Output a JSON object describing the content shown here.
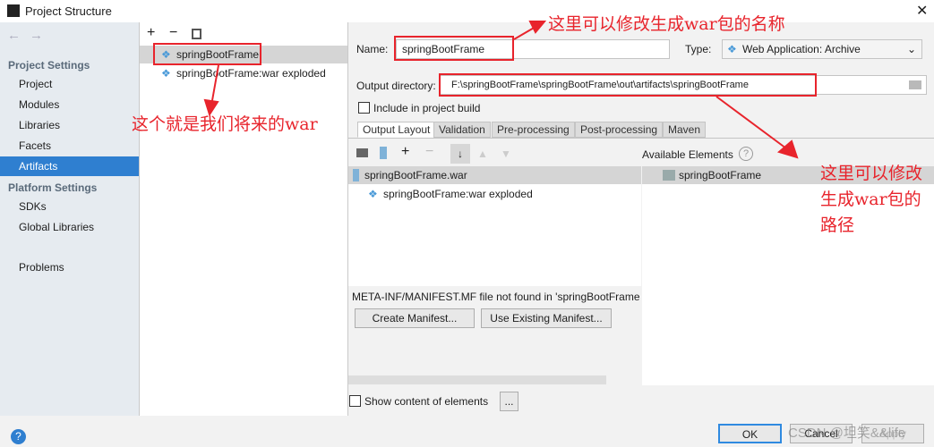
{
  "window": {
    "title": "Project Structure",
    "close_icon": "close-icon"
  },
  "sidebar": {
    "sections": [
      {
        "label": "Project Settings",
        "items": [
          "Project",
          "Modules",
          "Libraries",
          "Facets",
          "Artifacts"
        ]
      },
      {
        "label": "Platform Settings",
        "items": [
          "SDKs",
          "Global Libraries"
        ]
      }
    ],
    "extra": "Problems",
    "selected": "Artifacts"
  },
  "artifacts": {
    "items": [
      "springBootFrame",
      "springBootFrame:war exploded"
    ],
    "selected": "springBootFrame"
  },
  "form": {
    "name_label": "Name:",
    "name_value": "springBootFrame",
    "type_label": "Type:",
    "type_value": "Web Application: Archive",
    "output_label": "Output directory:",
    "output_value": "F:\\springBootFrame\\springBootFrame\\out\\artifacts\\springBootFrame",
    "include_label": "Include in project build",
    "include_checked": false
  },
  "tabs": [
    "Output Layout",
    "Validation",
    "Pre-processing",
    "Post-processing",
    "Maven"
  ],
  "active_tab": "Output Layout",
  "layout": {
    "tree": [
      "springBootFrame.war",
      "springBootFrame:war exploded"
    ],
    "available_label": "Available Elements",
    "available": [
      "springBootFrame"
    ],
    "manifest_msg": "META-INF/MANIFEST.MF file not found in 'springBootFrame",
    "create_manifest": "Create Manifest...",
    "use_manifest": "Use Existing Manifest...",
    "show_content": "Show content of elements",
    "more": "..."
  },
  "footer": {
    "ok": "OK",
    "cancel": "Cancel",
    "apply": "Apply"
  },
  "annotations": {
    "a1": "这里可以修改生成war包的名称",
    "a2": "这个就是我们将来的war",
    "a3": "这里可以修改生成war包的路径",
    "color": "#e8242c"
  },
  "watermark": "CSDN @坦笑&&life"
}
